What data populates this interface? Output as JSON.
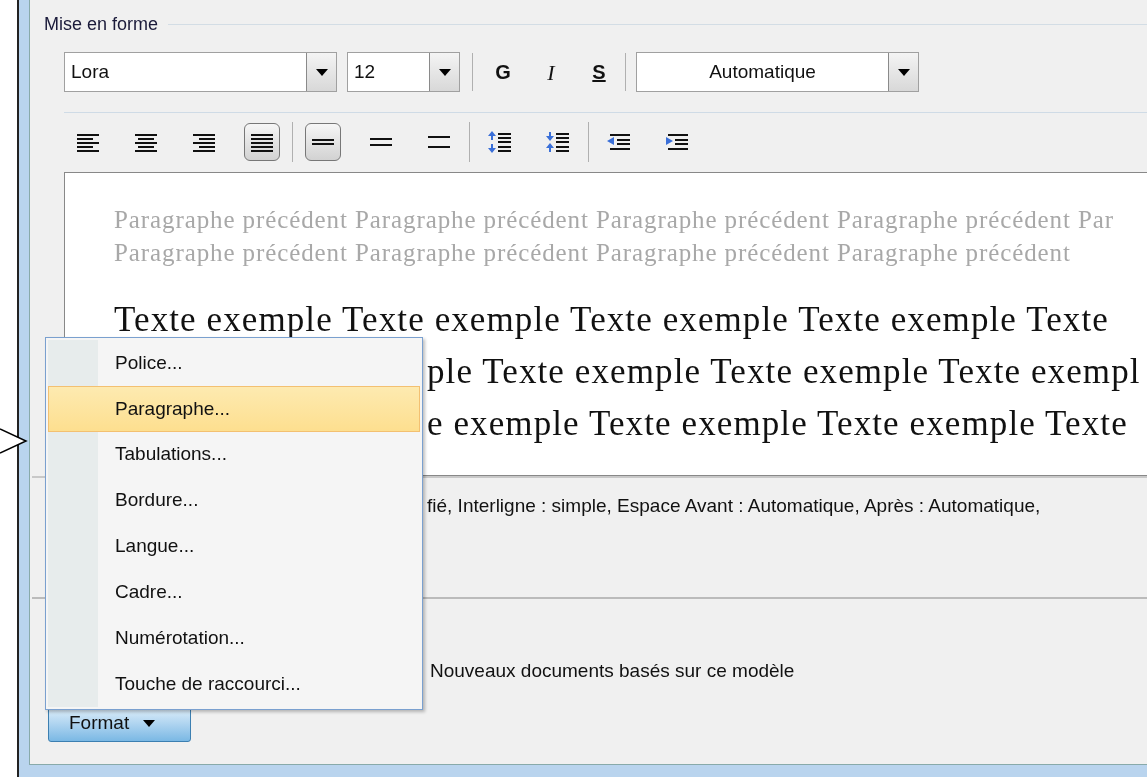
{
  "group_title": "Mise en forme",
  "font_toolbar": {
    "font": {
      "value": "Lora"
    },
    "size": {
      "value": "12"
    },
    "style_buttons": [
      {
        "kind": "bold",
        "label": "G"
      },
      {
        "kind": "italic",
        "label": "I"
      },
      {
        "kind": "underline",
        "label": "S"
      }
    ],
    "color": {
      "value": "Automatique"
    }
  },
  "paragraph_toolbar": {
    "groups": [
      [
        {
          "kind": "align-left",
          "selected": false
        },
        {
          "kind": "align-center",
          "selected": false
        },
        {
          "kind": "align-right",
          "selected": false
        },
        {
          "kind": "justify",
          "selected": true
        }
      ],
      [
        {
          "kind": "spacing-single",
          "selected": true
        },
        {
          "kind": "spacing-onehalf",
          "selected": false
        },
        {
          "kind": "spacing-double",
          "selected": false
        }
      ],
      [
        {
          "kind": "space-increase",
          "selected": false
        },
        {
          "kind": "space-decrease",
          "selected": false
        }
      ],
      [
        {
          "kind": "indent-decrease",
          "selected": false
        },
        {
          "kind": "indent-increase",
          "selected": false
        }
      ]
    ]
  },
  "preview": {
    "previous_lines": [
      "Paragraphe précédent Paragraphe précédent Paragraphe précédent Paragraphe précédent Par",
      "Paragraphe précédent Paragraphe précédent Paragraphe précédent Paragraphe précédent"
    ],
    "sample_lines": [
      {
        "text": "Texte exemple Texte exemple Texte exemple Texte exemple Texte",
        "covered": false
      },
      {
        "text": "ple Texte exemple Texte exemple Texte exempl",
        "covered": true
      },
      {
        "text": "e exemple Texte exemple Texte exemple Texte",
        "covered": true
      }
    ]
  },
  "description": "fié, Interligne : simple, Espace Avant : Automatique, Après : Automatique,",
  "new_documents_label": "Nouveaux documents basés sur ce modèle",
  "format_button": {
    "label": "Format"
  },
  "format_menu": [
    {
      "label": "Police...",
      "selected": false
    },
    {
      "label": "Paragraphe...",
      "selected": true
    },
    {
      "label": "Tabulations...",
      "selected": false
    },
    {
      "label": "Bordure...",
      "selected": false
    },
    {
      "label": "Langue...",
      "selected": false
    },
    {
      "label": "Cadre...",
      "selected": false
    },
    {
      "label": "Numérotation...",
      "selected": false
    },
    {
      "label": "Touche de raccourci...",
      "selected": false
    }
  ]
}
